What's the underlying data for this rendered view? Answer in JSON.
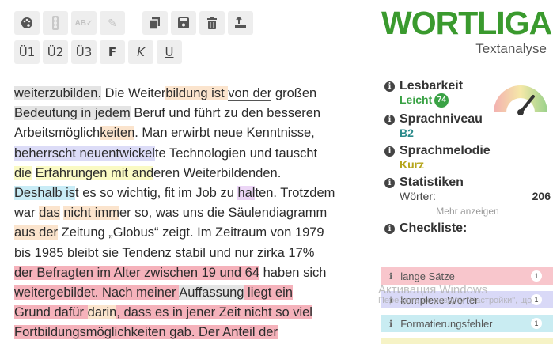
{
  "toolbar": {
    "row1": [
      {
        "icon": "palette-icon",
        "glyph": "🎨",
        "disabled": false
      },
      {
        "icon": "traffic-light-icon",
        "glyph": "⚐",
        "disabled": true
      },
      {
        "icon": "spellcheck-icon",
        "glyph": "ᴬᴮ",
        "disabled": true
      },
      {
        "icon": "pencil-icon",
        "glyph": "✎",
        "disabled": true
      },
      {
        "icon": "copy-icon",
        "glyph": "❐",
        "disabled": false
      },
      {
        "icon": "save-icon",
        "glyph": "💾",
        "disabled": false
      },
      {
        "icon": "trash-icon",
        "glyph": "🗑",
        "disabled": false
      },
      {
        "icon": "upload-icon",
        "glyph": "⤴",
        "disabled": false
      }
    ],
    "row2": {
      "u1": "Ü1",
      "u2": "Ü2",
      "u3": "Ü3",
      "bold": "F",
      "italic": "K",
      "underline": "U"
    }
  },
  "editor": {
    "lines": [
      "weiterzubilden. Die Weiterbildung ist von der großen",
      "Bedeutung in jedem Beruf und führt zu den besseren",
      "Arbeitsmöglichkeiten. Man erwirbt neue Kenntnisse,",
      "beherrscht neuentwickelte Technologien und tauscht",
      "die Erfahrungen mit anderen Weiterbildenden.",
      "Deshalb ist es so wichtig, fit im Job zu halten. Trotzdem",
      "war das nicht immer so, was uns die Säulendiagramm",
      "aus der Zeitung „Globus“ zeigt. Im Zeitraum von 1979",
      "bis 1985 bleibt sie Tendenz stabil und nur zirka 17%",
      "der Befragten im Alter zwischen 19 und 64 haben sich",
      "weitergebildet. Nach meiner Auffassung liegt ein",
      "Grund dafür darin, dass es in jener Zeit nicht so viel",
      "Fortbildungsmöglichkeiten gab. Der Anteil der"
    ]
  },
  "brand": {
    "title": "WORTLIGA",
    "subtitle": "Textanalyse"
  },
  "sections": {
    "lesbarkeit": {
      "label": "Lesbarkeit",
      "value": "Leicht",
      "score": "74"
    },
    "sprachniveau": {
      "label": "Sprachniveau",
      "value": "B2"
    },
    "sprachmelodie": {
      "label": "Sprachmelodie",
      "value": "Kurz"
    },
    "statistiken": {
      "label": "Statistiken",
      "row_label": "Wörter:",
      "row_value": "206",
      "more": "Mehr anzeigen"
    },
    "checkliste": {
      "label": "Checkliste:"
    }
  },
  "checklist": [
    {
      "label": "lange Sätze",
      "count": "1",
      "color": "#f8c6cc"
    },
    {
      "label": "komplexe Wörter",
      "count": "1",
      "color": "#d9d9f7"
    },
    {
      "label": "Formatierungsfehler",
      "count": "1",
      "color": "#c9ecf2"
    },
    {
      "label": "",
      "count": "",
      "color": "#f6f3c6"
    }
  ],
  "watermark": {
    "line1": "Активация Windows",
    "line2": "Перейдіть до розділу \"Настройки\", що"
  },
  "colors": {
    "brand_green": "#3a9a2e",
    "accent_green": "#3aa245",
    "accent_olive": "#b5a51a"
  }
}
